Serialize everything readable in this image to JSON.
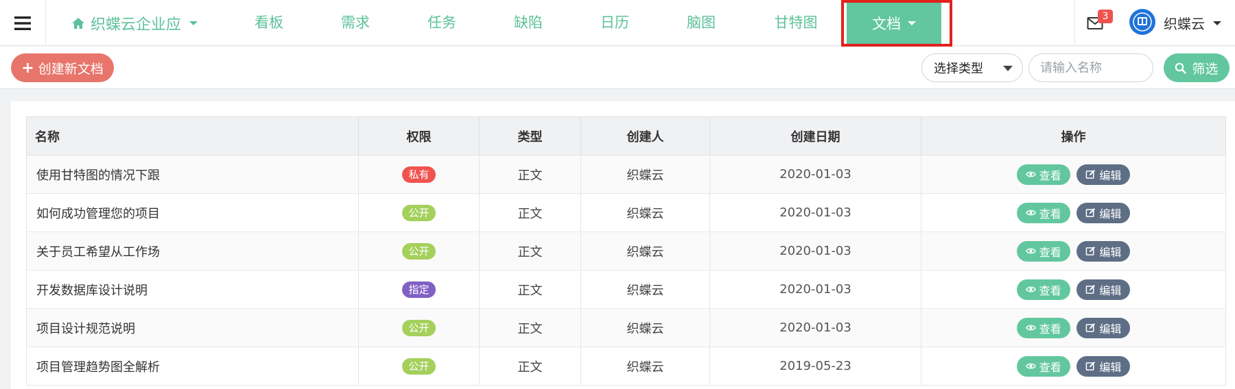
{
  "nav": {
    "brand_label": "织蝶云企业应",
    "items": [
      "看板",
      "需求",
      "任务",
      "缺陷",
      "日历",
      "脑图",
      "甘特图"
    ],
    "active_label": "文档",
    "mail_count": "3",
    "username": "织蝶云"
  },
  "toolbar": {
    "create_label": "创建新文档",
    "select_label": "选择类型",
    "search_placeholder": "请输入名称",
    "filter_label": "筛选"
  },
  "table": {
    "headers": [
      "名称",
      "权限",
      "类型",
      "创建人",
      "创建日期",
      "操作"
    ],
    "view_label": "查看",
    "edit_label": "编辑",
    "rows": [
      {
        "name": "使用甘特图的情况下跟",
        "perm": "私有",
        "perm_color": "#f0534f",
        "type": "正文",
        "creator": "织蝶云",
        "date": "2020-01-03"
      },
      {
        "name": "如何成功管理您的项目",
        "perm": "公开",
        "perm_color": "#a4d05c",
        "type": "正文",
        "creator": "织蝶云",
        "date": "2020-01-03"
      },
      {
        "name": "关于员工希望从工作场",
        "perm": "公开",
        "perm_color": "#a4d05c",
        "type": "正文",
        "creator": "织蝶云",
        "date": "2020-01-03"
      },
      {
        "name": "开发数据库设计说明",
        "perm": "指定",
        "perm_color": "#8060c4",
        "type": "正文",
        "creator": "织蝶云",
        "date": "2020-01-03"
      },
      {
        "name": "项目设计规范说明",
        "perm": "公开",
        "perm_color": "#a4d05c",
        "type": "正文",
        "creator": "织蝶云",
        "date": "2020-01-03"
      },
      {
        "name": "项目管理趋势图全解析",
        "perm": "公开",
        "perm_color": "#a4d05c",
        "type": "正文",
        "creator": "织蝶云",
        "date": "2019-05-23"
      }
    ]
  }
}
